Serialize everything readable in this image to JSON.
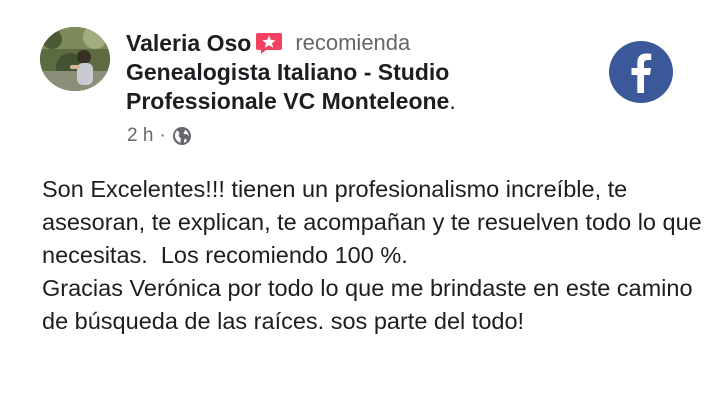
{
  "review": {
    "author_name": "Valeria Oso",
    "recommends_label": "recomienda",
    "page_name": "Genealogista Italiano - Studio Professionale VC Monteleone",
    "page_name_suffix": ".",
    "timestamp": "2 h",
    "meta_separator": "·",
    "privacy_icon": "globe-icon",
    "recommend_icon": "recommend-star-icon",
    "platform_logo": "facebook-logo",
    "body_text": "Son Excelentes!!! tienen un profesionalismo increíble, te asesoran, te explican, te acompañan y te resuelven todo lo que necesitas.  Los recomiendo 100 %.\nGracias Verónica por todo lo que me brindaste en este camino de búsqueda de las raíces. sos parte del todo!"
  },
  "colors": {
    "text_primary": "#1c1e21",
    "text_secondary": "#65676b",
    "recommend_badge": "#f3425f",
    "facebook_blue": "#3b5998"
  }
}
